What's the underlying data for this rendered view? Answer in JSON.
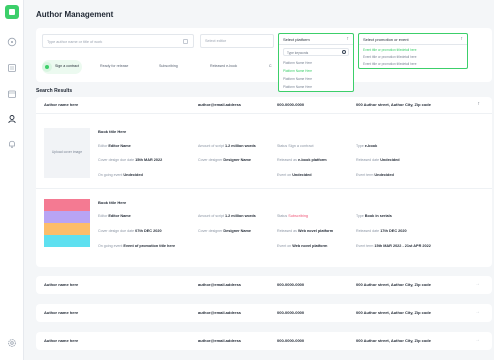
{
  "page": {
    "title": "Author Management"
  },
  "sidebar": {
    "icons": [
      "logo-icon",
      "dashboard-icon",
      "book-icon",
      "calendar-icon",
      "user-icon",
      "bell-icon",
      "settings-icon"
    ]
  },
  "filters": {
    "search_placeholder": "Type author name or title of work",
    "editor_placeholder": "Select editor",
    "platform": {
      "label": "Select platform",
      "search_placeholder": "Type keywords",
      "options": [
        "Platform Name Here",
        "Platform Name Here",
        "Platform Name Here"
      ],
      "highlighted_option": "Platform Name Here"
    },
    "promotion": {
      "label": "Select promotion or event",
      "options": [
        "Event title or promotion titledetail here",
        "Event title or promotion titledetail here",
        "Event title or promotion titledetail here"
      ]
    },
    "steps": [
      "Sign a contract",
      "Ready for release",
      "Subscribing",
      "Released e-book"
    ],
    "step_truncated": "C"
  },
  "results": {
    "section_title": "Search Results",
    "rows": [
      {
        "author": "Author name here",
        "email": "author@email.address",
        "phone": "000-0000-0000",
        "address": "000 Author street, Author City, Zip code",
        "expanded": true,
        "books": [
          {
            "cover_label": "Upload cover image",
            "title": "Book title Here",
            "editor_label": "Editor",
            "editor": "Editor Name",
            "amount_label": "Amount of script",
            "amount": "1.2 million words",
            "status_label": "Status",
            "status": "Sign a contract",
            "type_label": "Type",
            "type": "e-book",
            "cover_due_label": "Cover design due date",
            "cover_due": "15th MAR 2022",
            "designer_label": "Cover designer",
            "designer": "Designer Name",
            "released_as_label": "Released as",
            "released_as": "e-book platform",
            "released_date_label": "Released date",
            "released_date": "Undecided",
            "ongoing_label": "On going event",
            "ongoing": "Undecided",
            "event_label": "Event on",
            "event": "Undecided",
            "event_term_label": "Event term",
            "event_term": "Undecided"
          },
          {
            "title": "Book title Here",
            "cover_colors": [
              "#f47a92",
              "#b8a4f4",
              "#fcbd6a",
              "#5ee0f0"
            ],
            "editor_label": "Editor",
            "editor": "Editor Name",
            "amount_label": "Amount of script",
            "amount": "1.2 million words",
            "status_label": "Status",
            "status": "Subscribing",
            "type_label": "Type",
            "type": "Book in serials",
            "cover_due_label": "Cover design due date",
            "cover_due": "07th DEC 2020",
            "designer_label": "Cover designer",
            "designer": "Designer Name",
            "released_as_label": "Released as",
            "released_as": "Web novel platform",
            "released_date_label": "Released date",
            "released_date": "17th DEC 2020",
            "ongoing_label": "On going event",
            "ongoing": "Event of promotion title here",
            "event_label": "Event on",
            "event": "Web novel platform",
            "event_term_label": "Event term",
            "event_term": "15th MAR 2022 - 21st APR 2022"
          }
        ]
      },
      {
        "author": "Author name here",
        "email": "author@email.address",
        "phone": "000-0000-0000",
        "address": "000 Author street, Author City, Zip code"
      },
      {
        "author": "Author name here",
        "email": "author@email.address",
        "phone": "000-0000-0000",
        "address": "000 Author street, Author City, Zip code"
      },
      {
        "author": "Author name here",
        "email": "author@email.address",
        "phone": "000-0000-0000",
        "address": "000 Author street, Author City, Zip code"
      }
    ]
  },
  "colors": {
    "accent": "#3ccf6a",
    "status_red": "#ef5476",
    "background": "#f4f6f8"
  }
}
